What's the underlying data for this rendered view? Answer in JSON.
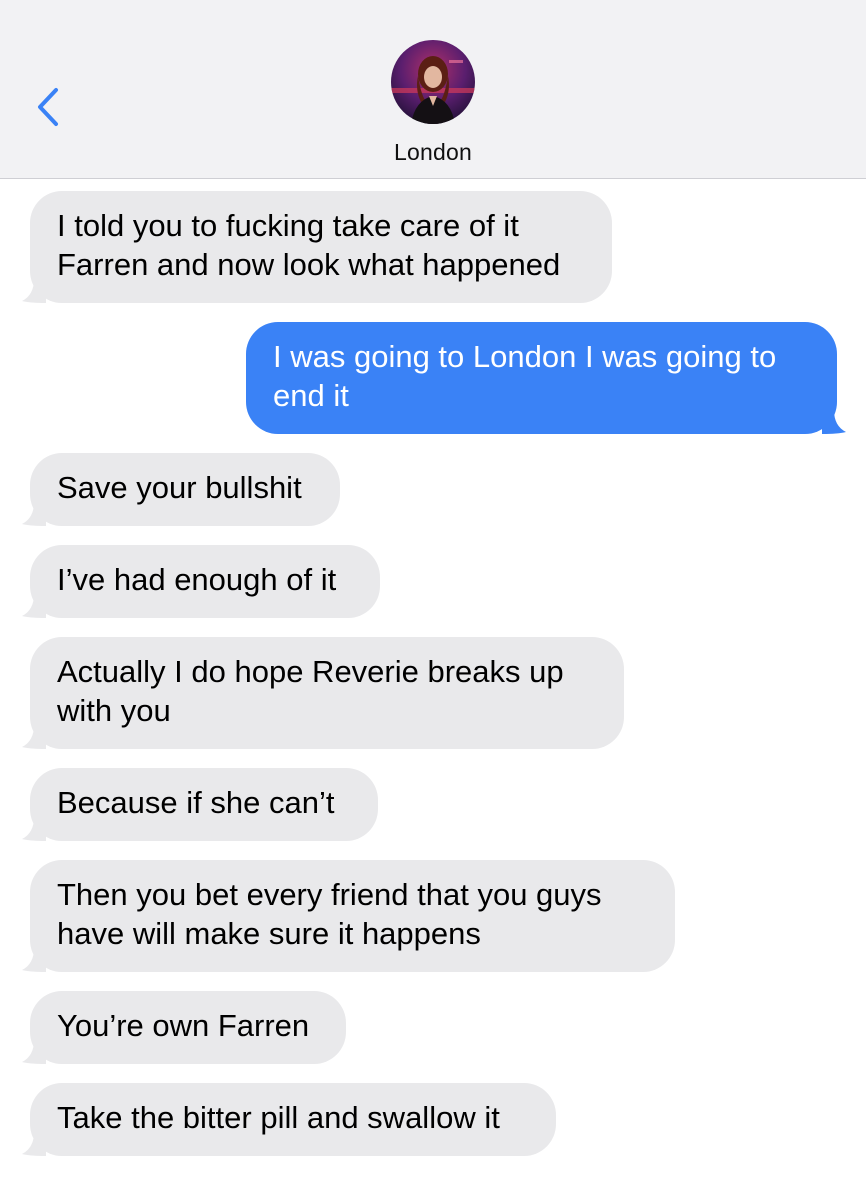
{
  "header": {
    "contact_name": "London",
    "back_icon": "chevron-left-icon",
    "accent_color": "#3a82f6"
  },
  "messages": [
    {
      "direction": "in",
      "lines": [
        "I told you to fucking take care of it",
        "Farren and now look what happened"
      ]
    },
    {
      "direction": "out",
      "lines": [
        "I was going to London I was going to",
        "end it"
      ]
    },
    {
      "direction": "in",
      "lines": [
        "Save your bullshit"
      ]
    },
    {
      "direction": "in",
      "lines": [
        "I’ve had enough of it"
      ]
    },
    {
      "direction": "in",
      "lines": [
        "Actually I do hope Reverie breaks up",
        "with you"
      ]
    },
    {
      "direction": "in",
      "lines": [
        "Because if she can’t"
      ]
    },
    {
      "direction": "in",
      "lines": [
        "Then you bet every friend that you guys",
        "have will make sure it happens"
      ]
    },
    {
      "direction": "in",
      "lines": [
        "You’re own Farren"
      ]
    },
    {
      "direction": "in",
      "lines": [
        "Take the bitter pill and swallow it"
      ]
    }
  ]
}
